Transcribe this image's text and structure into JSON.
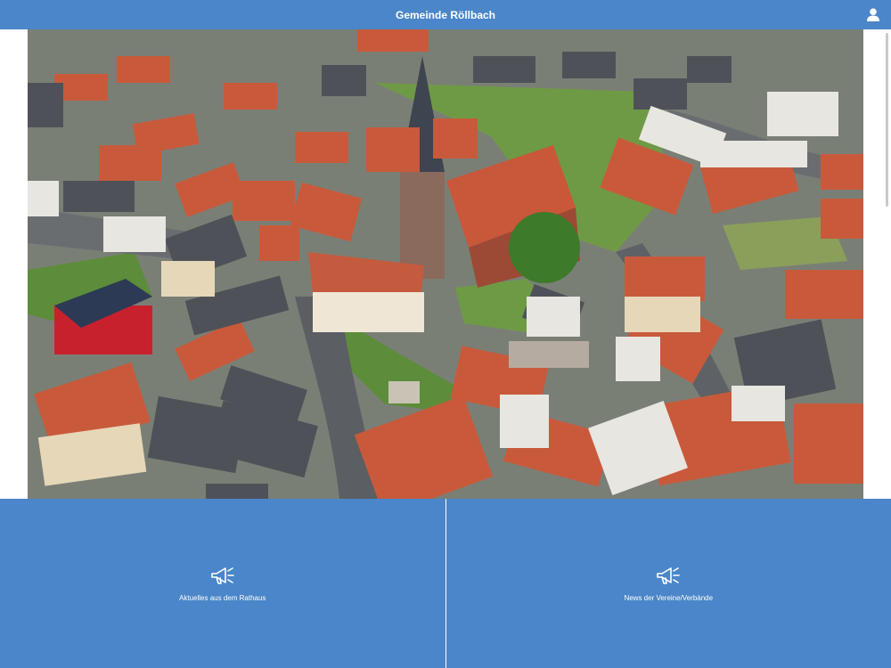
{
  "header": {
    "title": "Gemeinde Röllbach",
    "user_icon": "user-icon"
  },
  "hero": {
    "image": "aerial-village-photo"
  },
  "tiles": [
    {
      "label": "Aktuelles aus dem Rathaus",
      "icon": "megaphone-icon"
    },
    {
      "label": "News der Vereine/Verbände",
      "icon": "megaphone-icon"
    }
  ],
  "colors": {
    "primary": "#4a86c9",
    "text_on_primary": "#ffffff"
  }
}
